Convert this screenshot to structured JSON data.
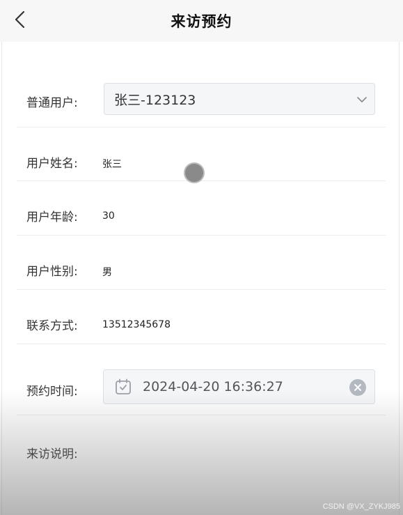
{
  "header": {
    "title": "来访预约"
  },
  "form": {
    "user_select": {
      "label": "普通用户:",
      "value": "张三-123123"
    },
    "name": {
      "label": "用户姓名:",
      "value": "张三"
    },
    "age": {
      "label": "用户年龄:",
      "value": "30"
    },
    "gender": {
      "label": "用户性别:",
      "value": "男"
    },
    "contact": {
      "label": "联系方式:",
      "value": "13512345678"
    },
    "appointment_time": {
      "label": "预约时间:",
      "value": "2024-04-20 16:36:27"
    },
    "visit_note": {
      "label": "来访说明:",
      "value": ""
    }
  },
  "icons": {
    "back": "back-arrow-icon",
    "dropdown": "chevron-down-icon",
    "calendar": "calendar-icon",
    "clear": "clear-icon"
  },
  "watermark": "CSDN @VX_ZYKJ985"
}
